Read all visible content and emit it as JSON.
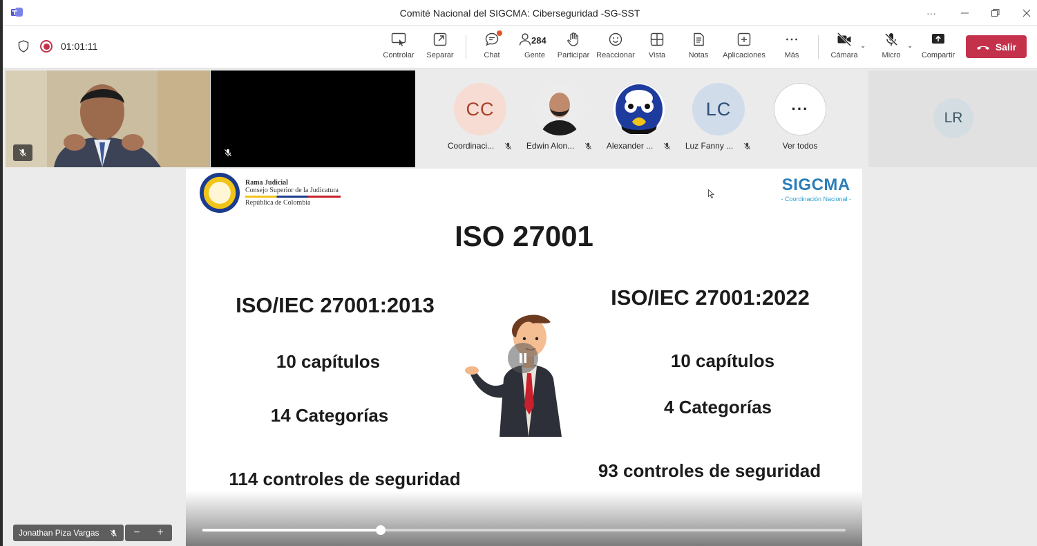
{
  "window": {
    "title": "Comité Nacional del SIGCMA: Ciberseguridad -SG-SST"
  },
  "toolbar": {
    "timer": "01:01:11",
    "buttons": [
      {
        "label": "Controlar",
        "icon": "control-icon"
      },
      {
        "label": "Separar",
        "icon": "pop-out-icon"
      },
      {
        "label": "Chat",
        "icon": "chat-icon"
      },
      {
        "label": "Gente",
        "icon": "people-icon"
      },
      {
        "label": "Participar",
        "icon": "raise-hand-icon"
      },
      {
        "label": "Reaccionar",
        "icon": "reaction-icon"
      },
      {
        "label": "Vista",
        "icon": "view-icon"
      },
      {
        "label": "Notas",
        "icon": "notes-icon"
      },
      {
        "label": "Aplicaciones",
        "icon": "apps-icon"
      },
      {
        "label": "Más",
        "icon": "more-icon"
      },
      {
        "label": "Cámara",
        "icon": "camera-off-icon"
      },
      {
        "label": "Micro",
        "icon": "mic-off-icon"
      },
      {
        "label": "Compartir",
        "icon": "share-icon"
      }
    ],
    "people_count": "284",
    "leave_label": "Salir",
    "leave_color": "#c4314b"
  },
  "participants": [
    {
      "initials": "CC",
      "name": "Coordinaci...",
      "bg": "#f6dcd3",
      "fg": "#a8412a"
    },
    {
      "initials": "",
      "name": "Edwin Alon...",
      "bg": "#e9e9e9",
      "fg": "#242424"
    },
    {
      "initials": "",
      "name": "Alexander ...",
      "bg": "#1e3c9e",
      "fg": "#ffffff"
    },
    {
      "initials": "LC",
      "name": "Luz Fanny ...",
      "bg": "#d0dcea",
      "fg": "#2a4e78"
    },
    {
      "initials": "···",
      "name": "Ver todos",
      "bg": "#ffffff",
      "fg": "#242424"
    }
  ],
  "side_tile": {
    "initials": "LR"
  },
  "slide": {
    "org_line1": "Rama Judicial",
    "org_line2": "Consejo Superior de la Judicatura",
    "org_line3": "República de Colombia",
    "logo_title": "SIGCMA",
    "logo_subtitle": "- Coordinación Nacional -",
    "title": "ISO 27001",
    "left": {
      "heading": "ISO/IEC 27001:2013",
      "chapters": "10 capítulos",
      "categories": "14 Categorías",
      "controls": "114 controles de seguridad"
    },
    "right": {
      "heading": "ISO/IEC 27001:2022",
      "chapters": "10 capítulos",
      "categories": "4 Categorías",
      "controls": "93 controles de seguridad"
    },
    "playback_progress": 0.277
  },
  "presenter": {
    "name": "Jonathan Piza Vargas",
    "zoom_out": "−",
    "zoom_in": "+"
  }
}
